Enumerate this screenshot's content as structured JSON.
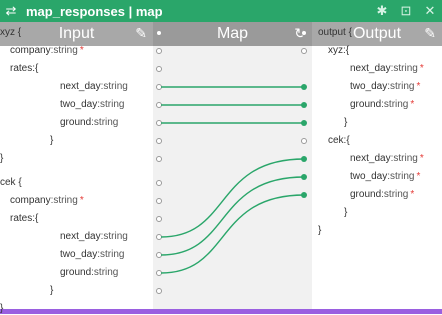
{
  "window": {
    "title": "map_responses | map",
    "swap_icon": "⇄",
    "pin_icon": "✱",
    "expand_icon": "⊡",
    "close_icon": "✕"
  },
  "columns": {
    "input": {
      "label": "Input",
      "icon": "✎"
    },
    "map": {
      "label": "Map",
      "icon": "↻"
    },
    "output": {
      "label": "Output",
      "icon": "✎"
    }
  },
  "input_tree": [
    {
      "text": "xyz {",
      "type": "",
      "required": false
    },
    {
      "text": "company",
      "type": ":string",
      "required": true
    },
    {
      "text": "rates:{",
      "type": "",
      "required": false
    },
    {
      "text": "next_day",
      "type": ":string",
      "required": false
    },
    {
      "text": "two_day",
      "type": ":string",
      "required": false
    },
    {
      "text": "ground",
      "type": ":string",
      "required": false
    },
    {
      "text": "}",
      "type": "",
      "required": false
    },
    {
      "text": "}",
      "type": "",
      "required": false
    },
    {
      "text": "cek {",
      "type": "",
      "required": false
    },
    {
      "text": "company",
      "type": ":string",
      "required": true
    },
    {
      "text": "rates:{",
      "type": "",
      "required": false
    },
    {
      "text": "next_day",
      "type": ":string",
      "required": false
    },
    {
      "text": "two_day",
      "type": ":string",
      "required": false
    },
    {
      "text": "ground",
      "type": ":string",
      "required": false
    },
    {
      "text": "}",
      "type": "",
      "required": false
    },
    {
      "text": "}",
      "type": "",
      "required": false
    }
  ],
  "output_tree": [
    {
      "text": "output {",
      "type": "",
      "required": false
    },
    {
      "text": "xyz:{",
      "type": "",
      "required": false
    },
    {
      "text": "next_day",
      "type": ":string",
      "required": true
    },
    {
      "text": "two_day",
      "type": ":string",
      "required": true
    },
    {
      "text": "ground",
      "type": ":string",
      "required": true
    },
    {
      "text": "}",
      "type": "",
      "required": false
    },
    {
      "text": "cek:{",
      "type": "",
      "required": false
    },
    {
      "text": "next_day",
      "type": ":string",
      "required": true
    },
    {
      "text": "two_day",
      "type": ":string",
      "required": true
    },
    {
      "text": "ground",
      "type": ":string",
      "required": true
    },
    {
      "text": "}",
      "type": "",
      "required": false
    },
    {
      "text": "}",
      "type": "",
      "required": false
    }
  ],
  "mappings": [
    {
      "from": "xyz.rates.next_day",
      "to": "output.xyz.next_day"
    },
    {
      "from": "xyz.rates.two_day",
      "to": "output.xyz.two_day"
    },
    {
      "from": "xyz.rates.ground",
      "to": "output.xyz.ground"
    },
    {
      "from": "cek.rates.next_day",
      "to": "output.cek.next_day"
    },
    {
      "from": "cek.rates.two_day",
      "to": "output.cek.two_day"
    },
    {
      "from": "cek.rates.ground",
      "to": "output.cek.ground"
    }
  ],
  "colors": {
    "accent": "#2aa66a",
    "wire": "#2aa66a",
    "required": "#e53935"
  }
}
